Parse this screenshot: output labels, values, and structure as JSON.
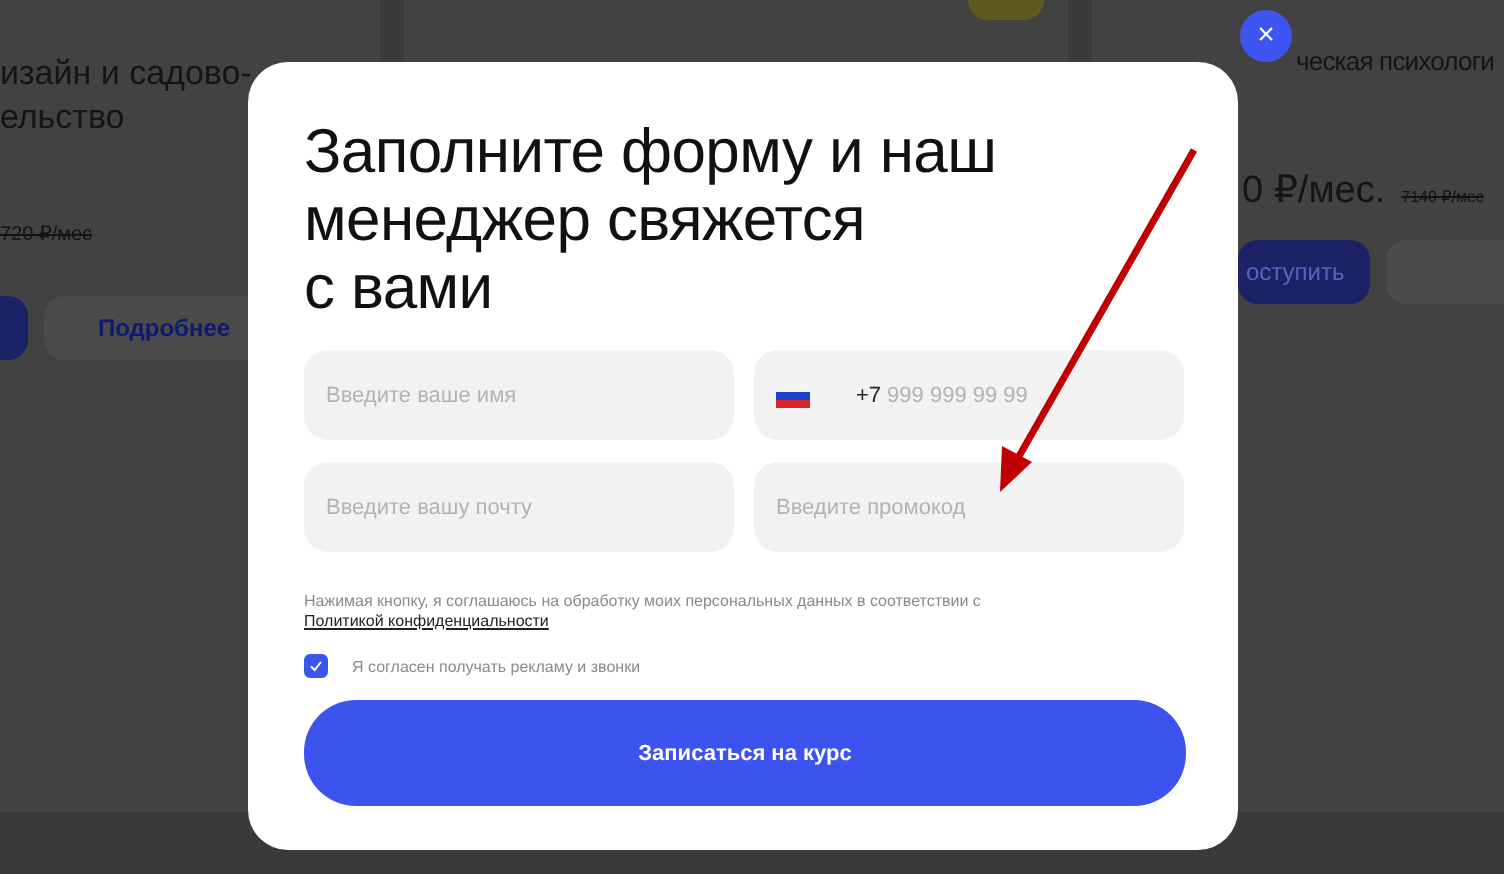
{
  "background_page": {
    "cards": [
      {
        "title": "изайн и садово-\nельство",
        "old_price": "720 ₽/мес",
        "secondary_button": "Подробнее"
      },
      {
        "title": "ческая психологи",
        "price": "0 ₽/мес.",
        "old_price": "7140 ₽/мес",
        "primary_button": "оступить"
      }
    ]
  },
  "modal": {
    "close_label": "×",
    "title_lines": [
      "Заполните форму и наш",
      "менеджер свяжется",
      "с вами"
    ],
    "fields": [
      {
        "kind": "text",
        "placeholder": "Введите ваше имя"
      },
      {
        "kind": "phone",
        "prefix": "+7",
        "placeholder": "999 999 99 99"
      },
      {
        "kind": "text",
        "placeholder": "Введите вашу почту"
      },
      {
        "kind": "text",
        "placeholder": "Введите промокод"
      }
    ],
    "consent_text": "Нажимая кнопку, я соглашаюсь на обработку моих персональных данных в соответствии с",
    "consent_link": "Политикой конфиденциальности",
    "ads_checkbox": {
      "label": "Я согласен получать рекламу и звонки",
      "checked": true
    },
    "submit": "Записаться на курс"
  }
}
